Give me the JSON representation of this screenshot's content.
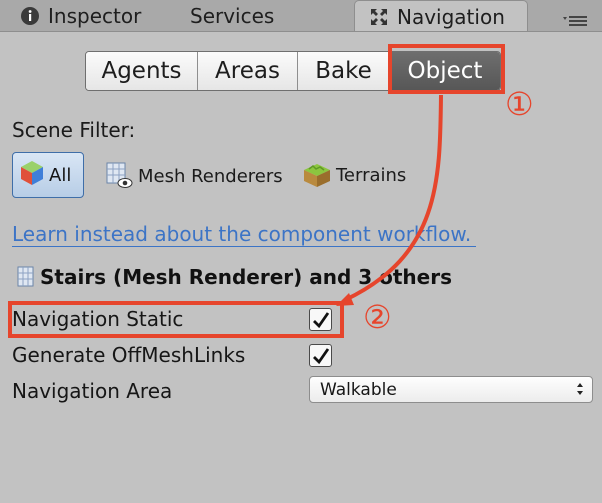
{
  "tabs": {
    "inspector": "Inspector",
    "services": "Services",
    "navigation": "Navigation"
  },
  "toolbar": {
    "agents": "Agents",
    "areas": "Areas",
    "bake": "Bake",
    "object": "Object",
    "selected": "Object"
  },
  "scene_filter": {
    "label": "Scene Filter:",
    "all": "All",
    "mesh_renderers": "Mesh Renderers",
    "terrains": "Terrains",
    "selected": "All"
  },
  "learn_link": "Learn instead about the component workflow.",
  "selection_title": "Stairs (Mesh Renderer) and 3 others",
  "properties": {
    "navigation_static": {
      "label": "Navigation Static",
      "checked": true
    },
    "generate_offmeshlinks": {
      "label": "Generate OffMeshLinks",
      "checked": true
    },
    "navigation_area": {
      "label": "Navigation Area",
      "value": "Walkable"
    }
  },
  "annotations": {
    "step1": "①",
    "step2": "②",
    "color": "#e6452c"
  },
  "colors": {
    "panel_bg": "#c2c2c2",
    "selected_segment": "#5f5f5f",
    "link": "#3c74c6"
  }
}
